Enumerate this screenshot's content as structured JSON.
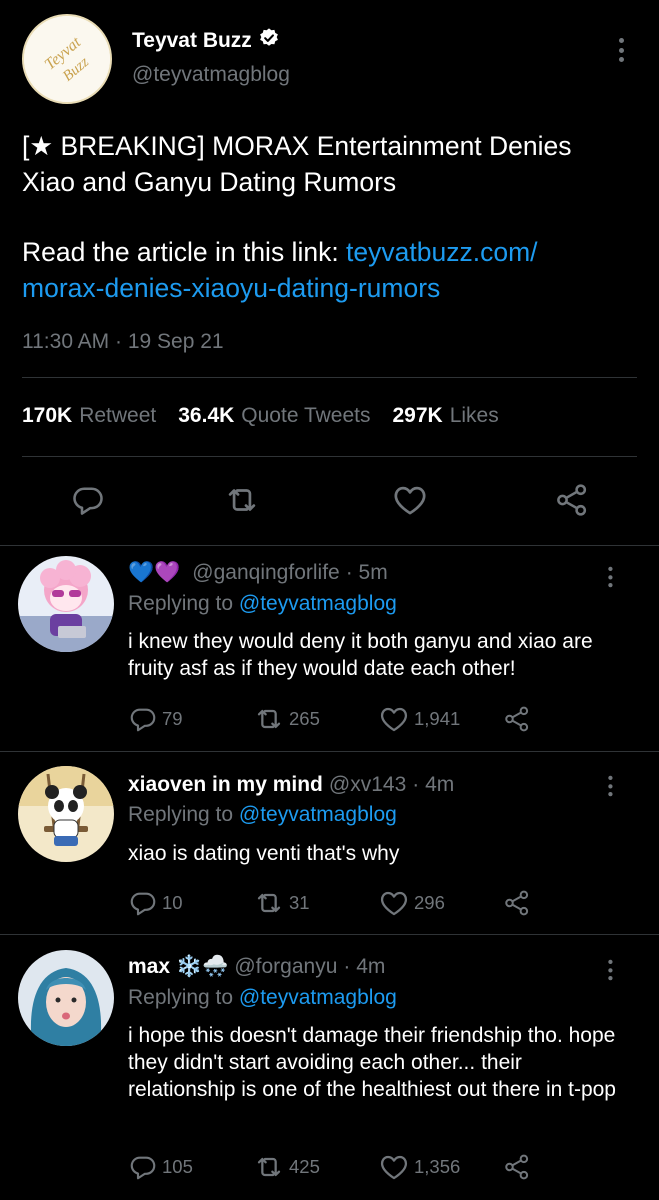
{
  "main_tweet": {
    "avatar_text": "Teyvat Buzz",
    "author_name": "Teyvat Buzz",
    "author_handle": "@teyvatmagblog",
    "text_line1": "[★ BREAKING] MORAX Entertainment Denies",
    "text_line2": "Xiao and Ganyu Dating Rumors",
    "text_line3_prefix": "Read the article in this link: ",
    "link_part1": "teyvatbuzz.com/",
    "link_part2": "morax-denies-xiaoyu-dating-rumors",
    "timestamp": "11:30 AM · 19 Sep 21",
    "stats": [
      {
        "count": "170K",
        "label": "Retweet"
      },
      {
        "count": "36.4K",
        "label": "Quote Tweets"
      },
      {
        "count": "297K",
        "label": "Likes"
      }
    ]
  },
  "replies": [
    {
      "name": "",
      "name_emoji": "💙💜",
      "handle": "@ganqingforlife",
      "time": "· 5m",
      "replying_prefix": "Replying to ",
      "replying_to": "@teyvatmagblog",
      "text": "i knew they would deny it both ganyu and xiao are fruity asf as if they would date each other!",
      "replies": "79",
      "retweets": "265",
      "likes": "1,941"
    },
    {
      "name": "xiaoven in my mind",
      "name_emoji": "",
      "handle": "@xv143",
      "time": "· 4m",
      "replying_prefix": "Replying to ",
      "replying_to": "@teyvatmagblog",
      "text": "xiao is dating venti that's why",
      "replies": "10",
      "retweets": "31",
      "likes": "296"
    },
    {
      "name": "max",
      "name_emoji": "❄️🌨️",
      "handle": "@forganyu",
      "time": "· 4m",
      "replying_prefix": "Replying to ",
      "replying_to": "@teyvatmagblog",
      "text": "i hope this doesn't damage their friendship tho. hope they didn't start avoiding each other... their relationship is one of the healthiest out there in t-pop",
      "replies": "105",
      "retweets": "425",
      "likes": "1,356"
    }
  ],
  "colors": {
    "background": "#000000",
    "text": "#e7e9ea",
    "muted": "#71767b",
    "link": "#1d9bf0",
    "divider": "#2f3336"
  }
}
